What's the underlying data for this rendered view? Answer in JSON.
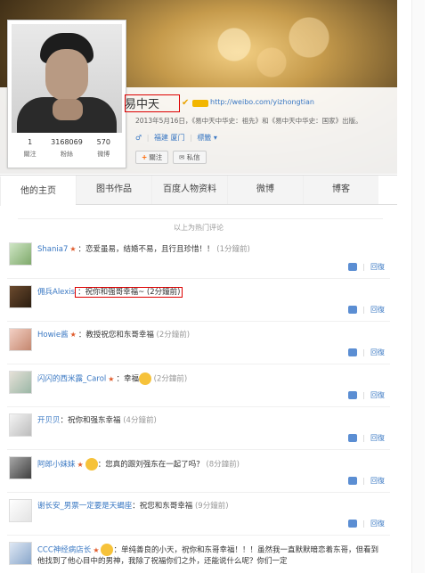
{
  "profile": {
    "name": "易中天",
    "url": "http://weibo.com/yizhongtian",
    "description": "2013年5月16日，《易中天中华史：祖先》和《易中天中华史：国家》出版。",
    "gender": "♂",
    "location": "福建 厦门",
    "tag_label": "標籤 ▾",
    "stats": [
      {
        "value": "1",
        "label": "關注"
      },
      {
        "value": "3168069",
        "label": "粉絲"
      },
      {
        "value": "570",
        "label": "微博"
      }
    ],
    "follow_label": "關注",
    "message_label": "私信"
  },
  "tabs": [
    "他的主页",
    "图书作品",
    "百度人物资料",
    "微博",
    "博客"
  ],
  "hot_header": "以上为热门评论",
  "comments": [
    {
      "user": "Shania7",
      "text": "：恋爱虽易，结婚不易，且行且珍惜！！",
      "time": "(1分鐘前)"
    },
    {
      "user": "佣兵Alexis",
      "text": "：祝你和强哥幸福~ (2分鐘前)",
      "time": ""
    },
    {
      "user": "Howie酱",
      "text": "：教授祝您和东哥幸福",
      "time": "(2分鐘前)"
    },
    {
      "user": "闪闪的西米露_Carol",
      "text": "：幸福",
      "time": "(2分鐘前)"
    },
    {
      "user": "开贝贝",
      "text": "：祝你和强东幸福",
      "time": "(4分鐘前)"
    },
    {
      "user": "阿郎小妹妹",
      "text": "：您真的跟刘强东在一起了吗？",
      "time": "(8分鐘前)"
    },
    {
      "user": "谢长安_男票一定要是天蝎座",
      "text": "：祝您和东哥幸福",
      "time": "(9分鐘前)"
    },
    {
      "user": "CCC神经病店长",
      "text": "：单纯善良的小天，祝你和东哥幸福！！！虽然我一直默默暗恋着东哥，但看到他找到了他心目中的男神，我除了祝福你们之外，还能说什么呢？你们一定",
      "time": ""
    }
  ],
  "reply_label": "回復",
  "colors": {
    "link": "#3a78c3",
    "highlight_border": "#dd0000",
    "star": "#e05b2b"
  }
}
